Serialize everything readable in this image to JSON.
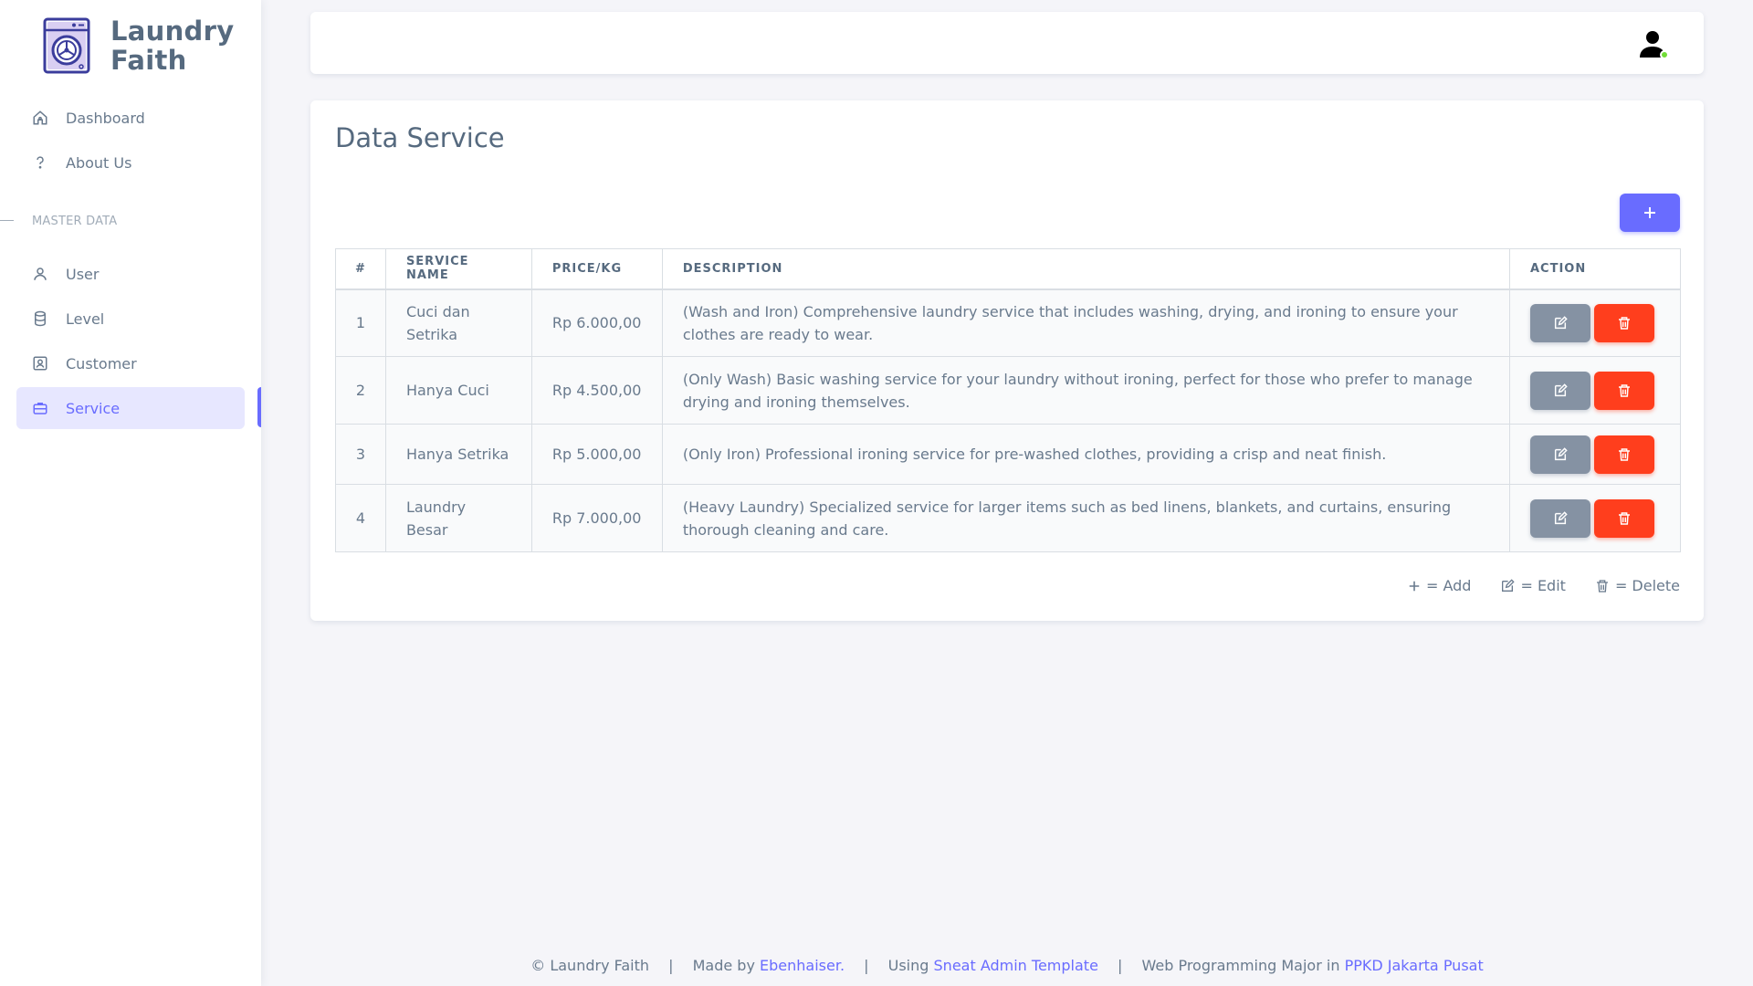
{
  "brand": {
    "name": "Laundry Faith"
  },
  "sidebar": {
    "items": [
      {
        "label": "Dashboard",
        "icon": "home-icon"
      },
      {
        "label": "About Us",
        "icon": "question-icon"
      }
    ],
    "section_header": "MASTER DATA",
    "master_items": [
      {
        "label": "User",
        "icon": "user-icon"
      },
      {
        "label": "Level",
        "icon": "database-icon"
      },
      {
        "label": "Customer",
        "icon": "user-card-icon"
      },
      {
        "label": "Service",
        "icon": "briefcase-icon",
        "active": true
      }
    ]
  },
  "page": {
    "title": "Data Service"
  },
  "table": {
    "headers": [
      "#",
      "SERVICE NAME",
      "PRICE/KG",
      "DESCRIPTION",
      "ACTION"
    ],
    "rows": [
      {
        "num": "1",
        "name": "Cuci dan Setrika",
        "price": "Rp 6.000,00",
        "desc": "(Wash and Iron) Comprehensive laundry service that includes washing, drying, and ironing to ensure your clothes are ready to wear."
      },
      {
        "num": "2",
        "name": "Hanya Cuci",
        "price": "Rp 4.500,00",
        "desc": "(Only Wash) Basic washing service for your laundry without ironing, perfect for those who prefer to manage drying and ironing themselves."
      },
      {
        "num": "3",
        "name": "Hanya Setrika",
        "price": "Rp 5.000,00",
        "desc": "(Only Iron) Professional ironing service for pre-washed clothes, providing a crisp and neat finish."
      },
      {
        "num": "4",
        "name": "Laundry Besar",
        "price": "Rp 7.000,00",
        "desc": "(Heavy Laundry) Specialized service for larger items such as bed linens, blankets, and curtains, ensuring thorough cleaning and care."
      }
    ]
  },
  "legend": {
    "add": "= Add",
    "edit": "= Edit",
    "delete": "= Delete"
  },
  "footer": {
    "copyright": "© Laundry Faith",
    "made_by_prefix": "Made by",
    "made_by_link": "Ebenhaiser.",
    "using_prefix": "Using",
    "using_link": "Sneat Admin Template",
    "major_prefix": "Web Programming Major in",
    "major_link": "PPKD Jakarta Pusat"
  },
  "colors": {
    "primary": "#696cff",
    "secondary": "#8592a3",
    "danger": "#ff3e1d",
    "online": "#71dd37"
  }
}
